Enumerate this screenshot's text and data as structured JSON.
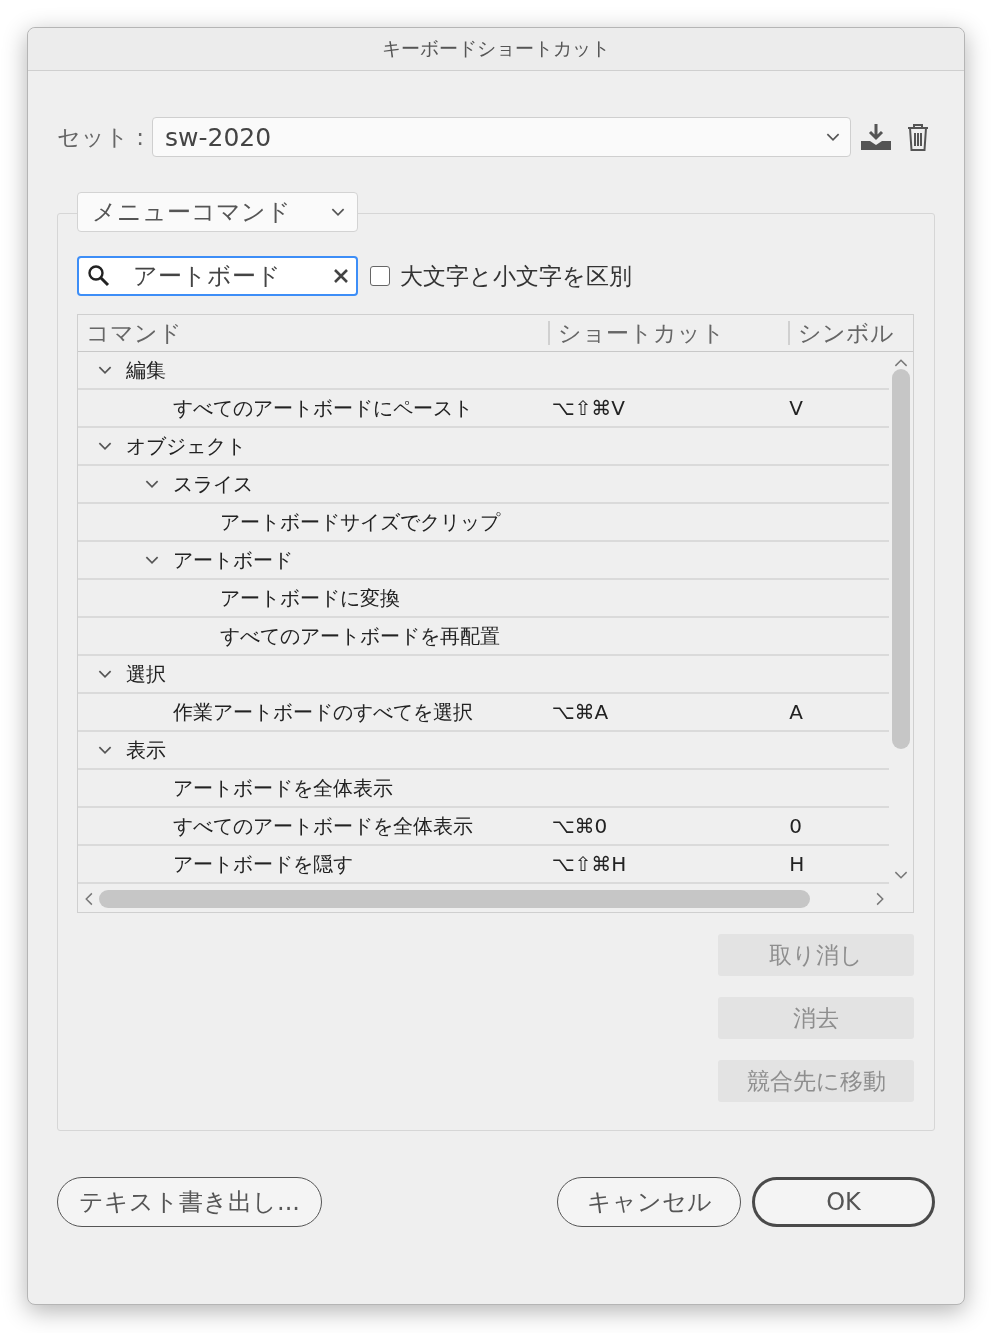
{
  "window": {
    "title": "キーボードショートカット"
  },
  "set": {
    "label": "セット :",
    "value": "sw-2020"
  },
  "category": {
    "value": "メニューコマンド"
  },
  "search": {
    "value": "アートボード"
  },
  "case_checkbox": {
    "label": "大文字と小文字を区別",
    "checked": false
  },
  "table": {
    "columns": [
      "コマンド",
      "ショートカット",
      "シンボル"
    ],
    "rows": [
      {
        "command": "編集",
        "expanded": true,
        "children": [
          {
            "command": "すべてのアートボードにペースト",
            "shortcut": "⌥⇧⌘V",
            "symbol": "V"
          }
        ]
      },
      {
        "command": "オブジェクト",
        "expanded": true,
        "children": [
          {
            "command": "スライス",
            "expanded": true,
            "children": [
              {
                "command": "アートボードサイズでクリップ"
              }
            ]
          },
          {
            "command": "アートボード",
            "expanded": true,
            "children": [
              {
                "command": "アートボードに変換"
              },
              {
                "command": "すべてのアートボードを再配置"
              }
            ]
          }
        ]
      },
      {
        "command": "選択",
        "expanded": true,
        "children": [
          {
            "command": "作業アートボードのすべてを選択",
            "shortcut": "⌥⌘A",
            "symbol": "A"
          }
        ]
      },
      {
        "command": "表示",
        "expanded": true,
        "children": [
          {
            "command": "アートボードを全体表示"
          },
          {
            "command": "すべてのアートボードを全体表示",
            "shortcut": "⌥⌘0",
            "symbol": "0"
          },
          {
            "command": "アートボードを隠す",
            "shortcut": "⌥⇧⌘H",
            "symbol": "H"
          }
        ]
      }
    ]
  },
  "side_buttons": [
    {
      "label": "取り消し",
      "disabled": true
    },
    {
      "label": "消去",
      "disabled": true
    },
    {
      "label": "競合先に移動",
      "disabled": true
    }
  ],
  "footer_buttons": [
    {
      "label": "テキスト書き出し...",
      "kind": "normal"
    },
    {
      "label": "キャンセル",
      "kind": "normal"
    },
    {
      "label": "OK",
      "kind": "default"
    }
  ]
}
